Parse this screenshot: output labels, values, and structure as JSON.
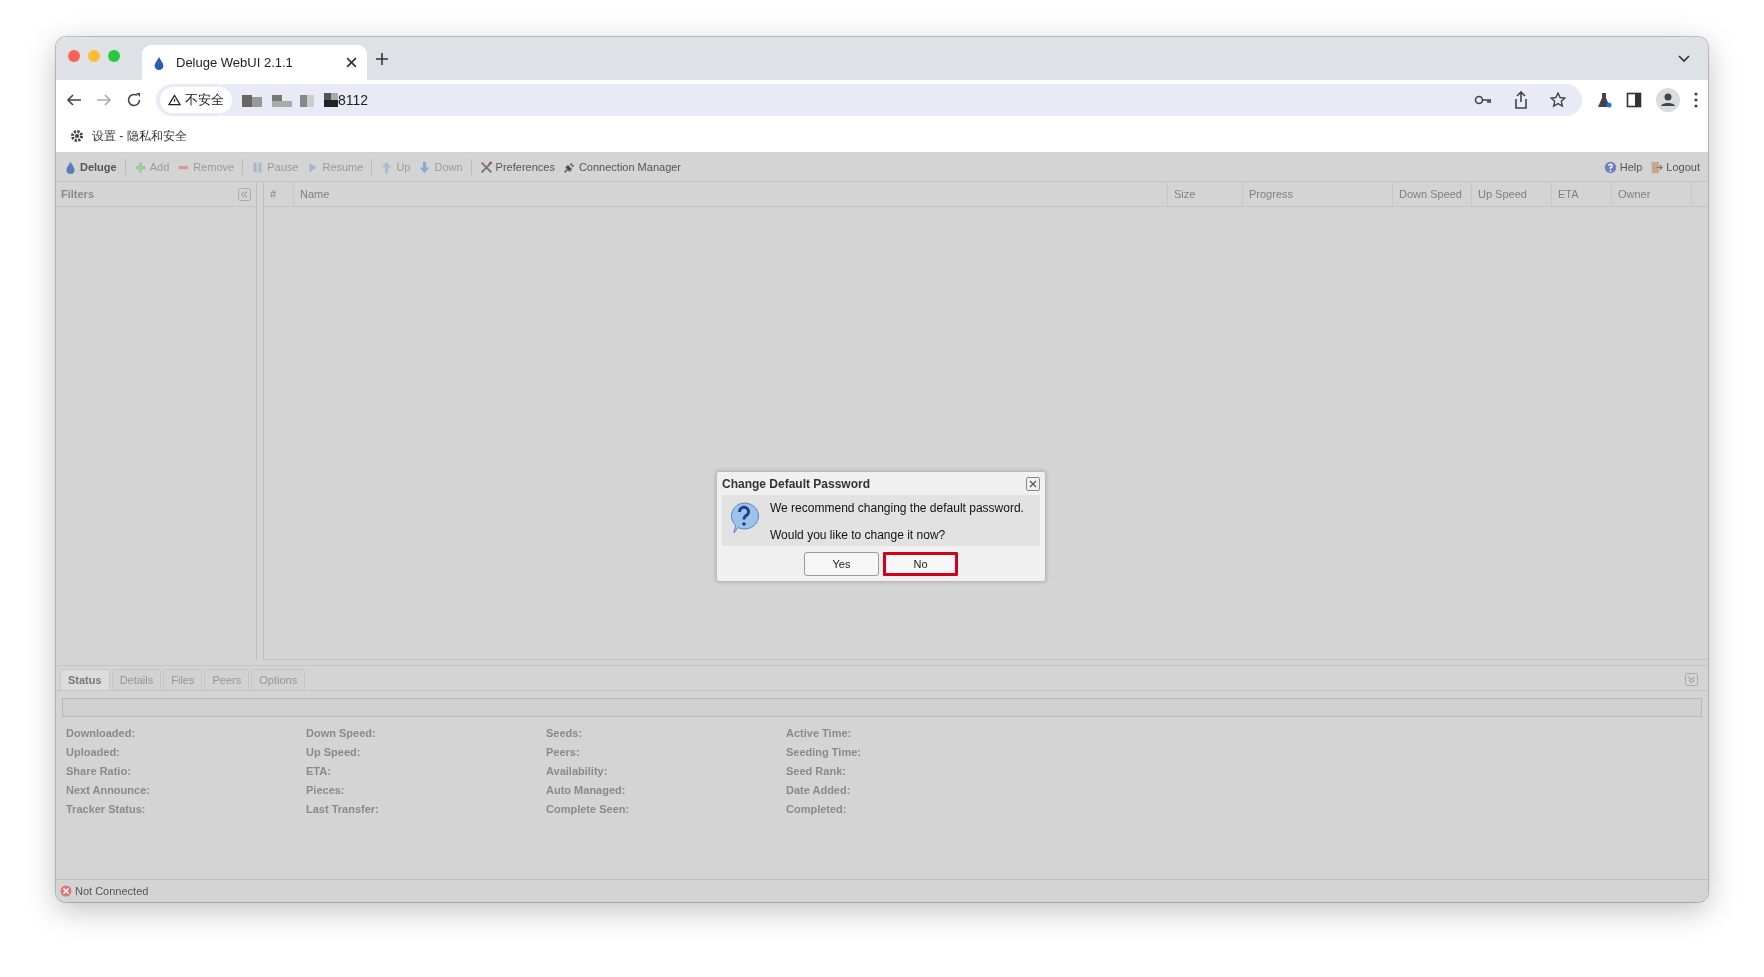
{
  "browser": {
    "tab_title": "Deluge WebUI 2.1.1",
    "security_label": "不安全",
    "url_visible": "8112",
    "bookmark": "设置 - 隐私和安全"
  },
  "toolbar": {
    "items": [
      {
        "kind": "brand",
        "label": "Deluge",
        "disabled": false
      },
      {
        "kind": "add",
        "label": "Add",
        "disabled": true
      },
      {
        "kind": "remove",
        "label": "Remove",
        "disabled": true
      },
      {
        "kind": "pause",
        "label": "Pause",
        "disabled": true
      },
      {
        "kind": "resume",
        "label": "Resume",
        "disabled": true
      },
      {
        "kind": "up",
        "label": "Up",
        "disabled": true
      },
      {
        "kind": "down",
        "label": "Down",
        "disabled": true
      },
      {
        "kind": "preferences",
        "label": "Preferences",
        "disabled": false
      },
      {
        "kind": "connection",
        "label": "Connection Manager",
        "disabled": false
      }
    ],
    "right": [
      {
        "kind": "help",
        "label": "Help"
      },
      {
        "kind": "logout",
        "label": "Logout"
      }
    ]
  },
  "filters": {
    "title": "Filters"
  },
  "columns": [
    "#",
    "Name",
    "Size",
    "Progress",
    "Down Speed",
    "Up Speed",
    "ETA",
    "Owner"
  ],
  "details_tabs": [
    {
      "label": "Status",
      "selected": true
    },
    {
      "label": "Details",
      "selected": false
    },
    {
      "label": "Files",
      "selected": false
    },
    {
      "label": "Peers",
      "selected": false
    },
    {
      "label": "Options",
      "selected": false
    }
  ],
  "progress": {
    "level": 0
  },
  "status_fields": [
    [
      "Downloaded:",
      "Uploaded:",
      "Share Ratio:",
      "Next Announce:",
      "Tracker Status:"
    ],
    [
      "Down Speed:",
      "Up Speed:",
      "ETA:",
      "Pieces:",
      "Last Transfer:"
    ],
    [
      "Seeds:",
      "Peers:",
      "Availability:",
      "Auto Managed:",
      "Complete Seen:"
    ],
    [
      "Active Time:",
      "Seeding Time:",
      "Seed Rank:",
      "Date Added:",
      "Completed:"
    ]
  ],
  "status_bar": "Not Connected",
  "dialog": {
    "title": "Change Default Password",
    "lines": [
      "We recommend changing the default password.",
      "Would you like to change it now?"
    ],
    "buttons": [
      {
        "label": "Yes",
        "highlighted": false
      },
      {
        "label": "No",
        "highlighted": true
      }
    ]
  }
}
